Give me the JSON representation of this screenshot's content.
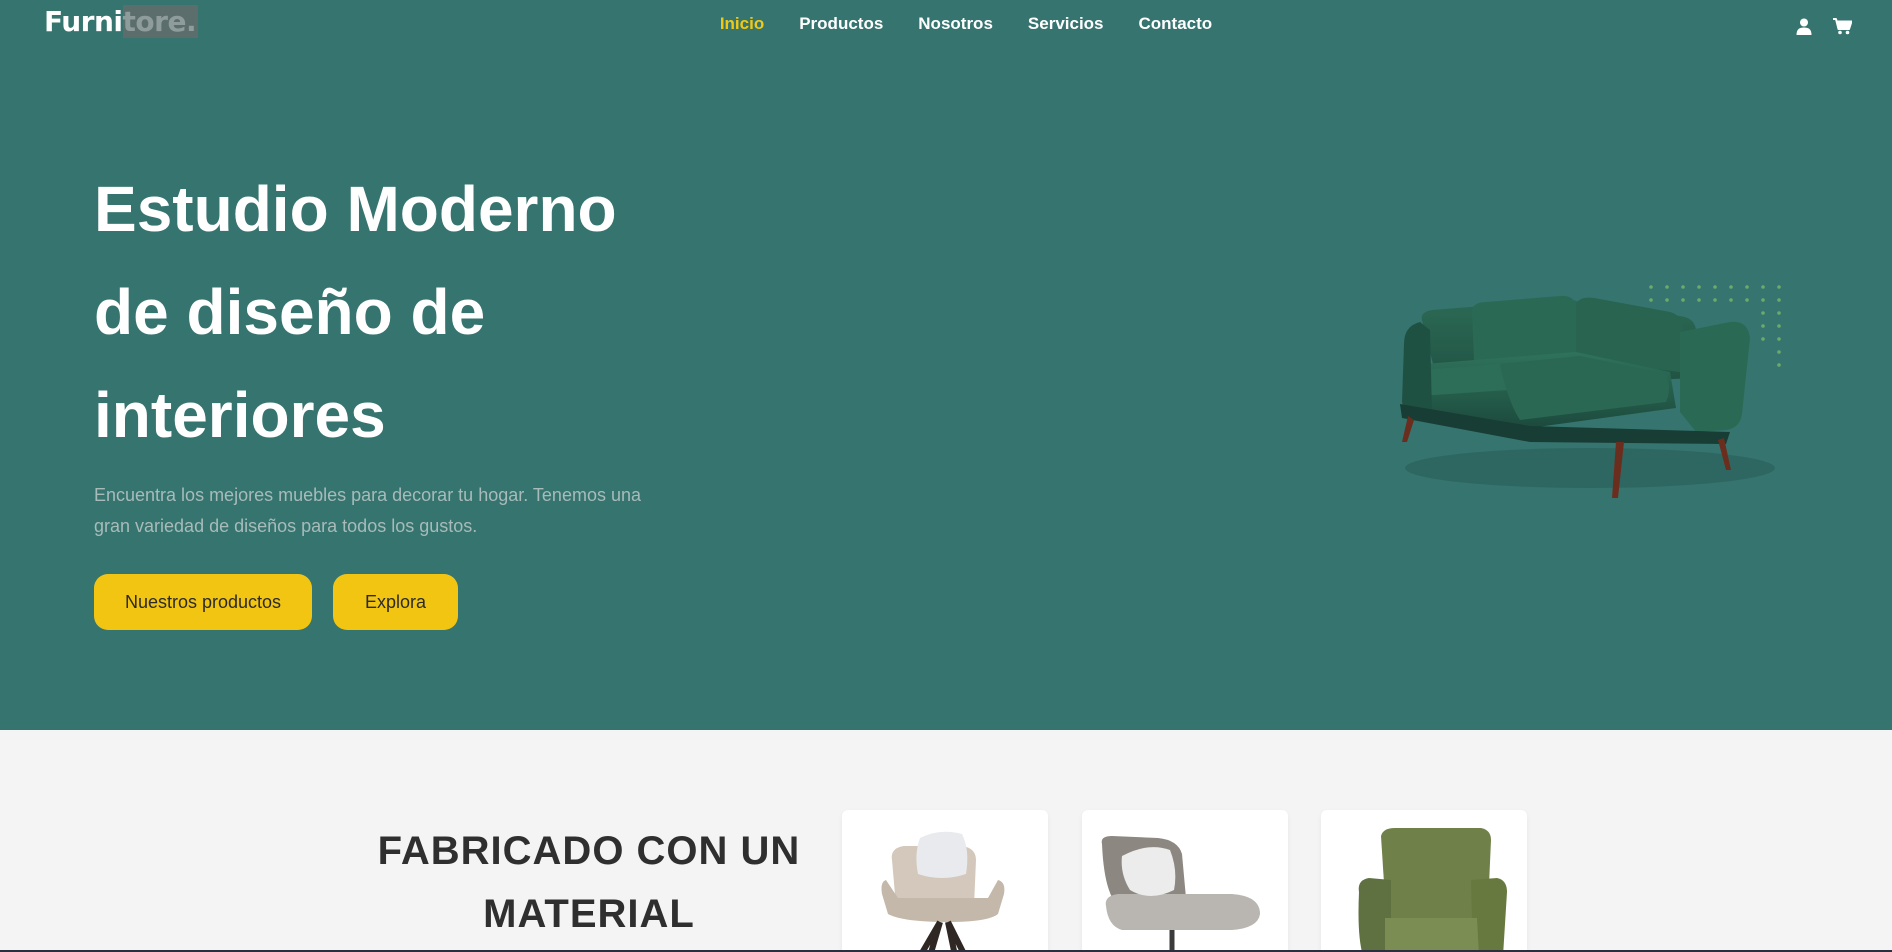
{
  "brand": {
    "logo_part1": "Furni",
    "logo_part2": "tore",
    "logo_dot": "."
  },
  "nav": {
    "links": [
      {
        "label": "Inicio",
        "active": true
      },
      {
        "label": "Productos",
        "active": false
      },
      {
        "label": "Nosotros",
        "active": false
      },
      {
        "label": "Servicios",
        "active": false
      },
      {
        "label": "Contacto",
        "active": false
      }
    ],
    "icons": [
      "user-icon",
      "cart-icon"
    ]
  },
  "hero": {
    "title_line1": "Estudio Moderno",
    "title_line2": "de diseño de",
    "title_line3": "interiores",
    "description_line1": "Encuentra los mejores muebles para decorar tu hogar. Tenemos una",
    "description_line2": "gran variedad de diseños para todos los gustos.",
    "primary_button": "Nuestros productos",
    "secondary_button": "Explora"
  },
  "section2": {
    "title_line1": "FABRICADO CON UN",
    "title_line2": "MATERIAL"
  },
  "colors": {
    "hero_bg": "#36746f",
    "accent": "#f2c512",
    "nav_active": "#f2c814",
    "section_bg": "#f4f4f4"
  }
}
